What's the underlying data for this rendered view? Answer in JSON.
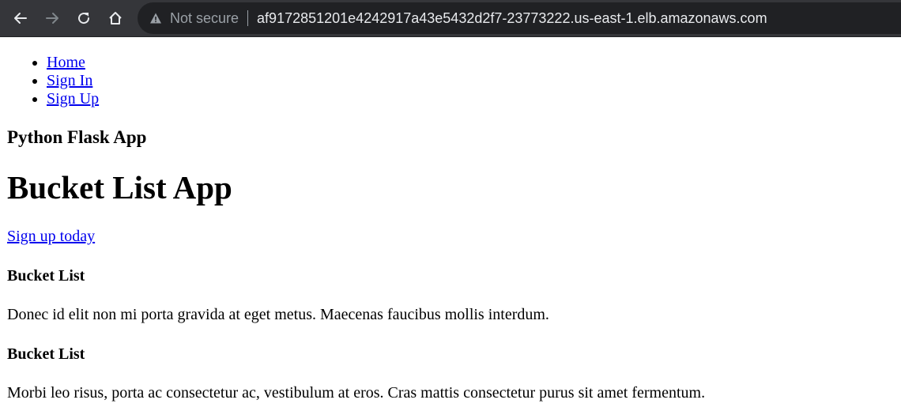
{
  "browser": {
    "security_label": "Not secure",
    "url": "af9172851201e4242917a43e5432d2f7-23773222.us-east-1.elb.amazonaws.com",
    "icons": {
      "back": "arrow-left-icon",
      "forward": "arrow-right-icon",
      "reload": "reload-icon",
      "home": "home-icon",
      "security": "warning-triangle-icon"
    },
    "colors": {
      "toolbar": "#35363a",
      "omnibox": "#202124",
      "url_text": "#e8eaed",
      "muted_text": "#9aa0a6"
    }
  },
  "nav": {
    "items": [
      {
        "label": "Home"
      },
      {
        "label": "Sign In"
      },
      {
        "label": "Sign Up"
      }
    ]
  },
  "header": {
    "subtitle": "Python Flask App",
    "title": "Bucket List App"
  },
  "cta": {
    "label": "Sign up today"
  },
  "sections": [
    {
      "heading": "Bucket List",
      "text": "Donec id elit non mi porta gravida at eget metus. Maecenas faucibus mollis interdum."
    },
    {
      "heading": "Bucket List",
      "text": "Morbi leo risus, porta ac consectetur ac, vestibulum at eros. Cras mattis consectetur purus sit amet fermentum."
    }
  ],
  "colors": {
    "link": "#0000ee",
    "text": "#000000",
    "background": "#ffffff"
  }
}
